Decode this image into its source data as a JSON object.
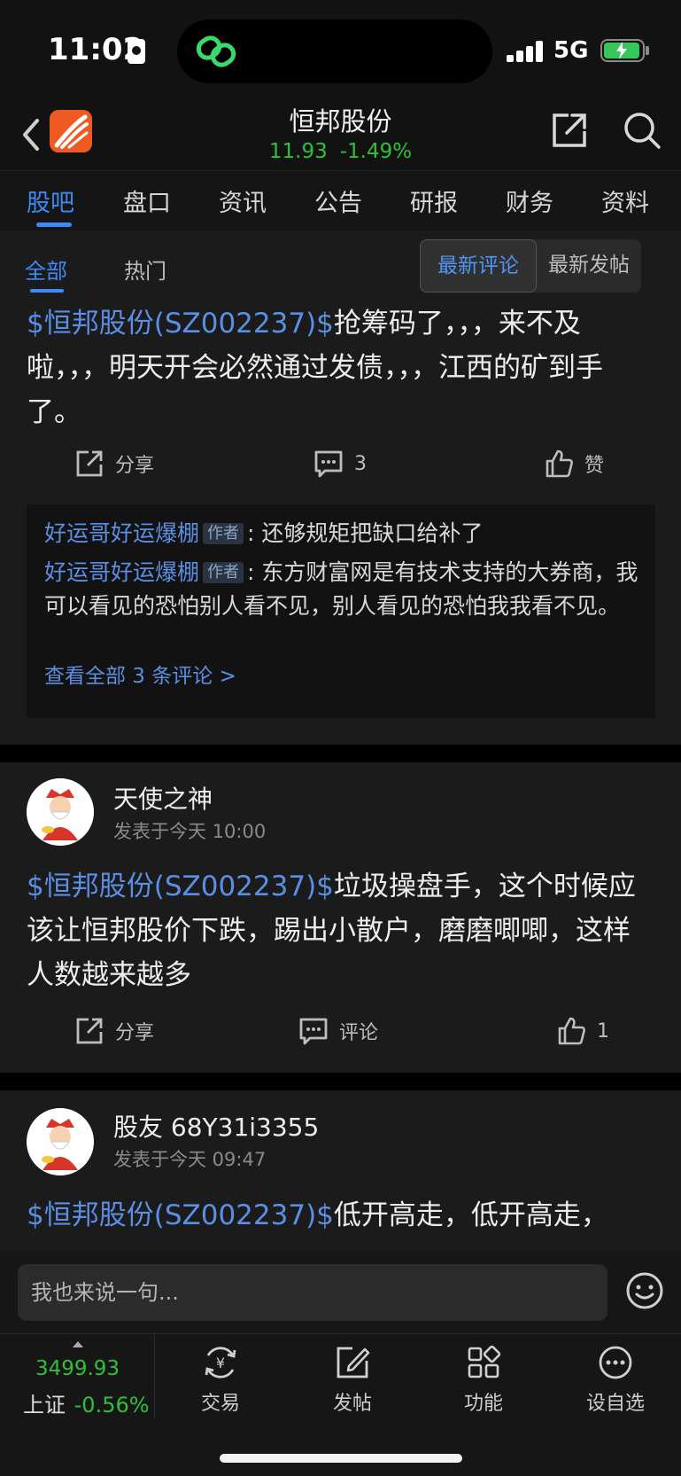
{
  "status_bar": {
    "time": "11:02",
    "network": "5G"
  },
  "header": {
    "stock_name": "恒邦股份",
    "price": "11.93",
    "change": "-1.49%"
  },
  "tabs": [
    {
      "label": "股吧"
    },
    {
      "label": "盘口"
    },
    {
      "label": "资讯"
    },
    {
      "label": "公告"
    },
    {
      "label": "研报"
    },
    {
      "label": "财务"
    },
    {
      "label": "资料"
    }
  ],
  "filters": {
    "all": "全部",
    "hot": "热门",
    "sort_latest_comment": "最新评论",
    "sort_latest_post": "最新发帖"
  },
  "posts": [
    {
      "stock_tag": "$恒邦股份(SZ002237)$",
      "text": "抢筹码了，，，来不及啦，，，明天开会必然通过发债，，，江西的矿到手了。",
      "share_label": "分享",
      "comment_count": "3",
      "like_label": "赞",
      "comments": [
        {
          "author": "好运哥好运爆棚",
          "tag": "作者",
          "sep": ":",
          "text": "还够规矩把缺口给补了"
        },
        {
          "author": "好运哥好运爆棚",
          "tag": "作者",
          "sep": ":",
          "text": "东方财富网是有技术支持的大券商，我可以看见的恐怕别人看不见，别人看见的恐怕我我看不见。"
        }
      ],
      "view_all": "查看全部 3 条评论 >"
    },
    {
      "username": "天使之神",
      "time": "发表于今天 10:00",
      "stock_tag": "$恒邦股份(SZ002237)$",
      "text": "垃圾操盘手，这个时候应该让恒邦股价下跌，踢出小散户，磨磨唧唧，这样人数越来越多",
      "share_label": "分享",
      "comment_label": "评论",
      "like_count": "1"
    },
    {
      "username": "股友 68Y31i3355",
      "time": "发表于今天 09:47",
      "stock_tag": "$恒邦股份(SZ002237)$",
      "text": "低开高走，低开高走，"
    }
  ],
  "input": {
    "placeholder": "我也来说一句..."
  },
  "bottom_nav": {
    "index_value": "3499.93",
    "index_name": "上证",
    "index_change": "-0.56%",
    "items": [
      {
        "label": "交易"
      },
      {
        "label": "发帖"
      },
      {
        "label": "功能"
      },
      {
        "label": "设自选"
      }
    ]
  },
  "colors": {
    "accent": "#3d8af7",
    "link": "#5a8fe4",
    "down_green": "#2fbf3a",
    "brand_orange": "#f05a22"
  },
  "icons": [
    "back-arrow-icon",
    "app-logo-icon",
    "share-icon",
    "search-icon",
    "comment-icon",
    "like-icon",
    "emoji-icon",
    "trade-icon",
    "edit-icon",
    "grid-icon",
    "more-icon"
  ]
}
